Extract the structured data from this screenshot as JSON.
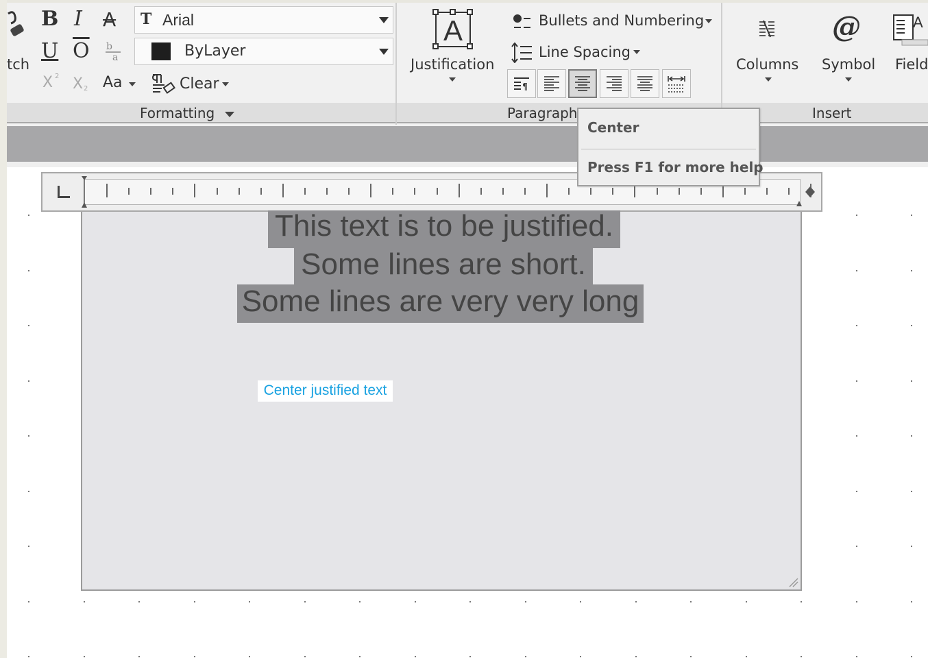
{
  "ribbon": {
    "partial_left_label": "tch",
    "formatting": {
      "bold": "B",
      "italic": "I",
      "strike": "A",
      "underline": "U",
      "overline": "O",
      "stack": "b/a",
      "superscript": "X",
      "subscript": "X",
      "change_case": "Aa",
      "font_value": "Arial",
      "color_value": "ByLayer",
      "clear_label": "Clear",
      "group_label": "Formatting"
    },
    "paragraph": {
      "justification_label": "Justification",
      "bullets_label": "Bullets and Numbering",
      "line_spacing_label": "Line Spacing",
      "group_label": "Paragraph"
    },
    "insert": {
      "columns_label": "Columns",
      "symbol_label": "Symbol",
      "field_label": "Field",
      "group_label": "Insert"
    }
  },
  "tooltip": {
    "title": "Center",
    "help": "Press F1 for more help"
  },
  "editor": {
    "lines": [
      "This text is to be justified.",
      "Some lines are short.",
      "Some lines are very very long"
    ],
    "annotation": "Center justified text"
  },
  "colors": {
    "accent_text": "#19a2e1",
    "highlight": "#8f8f92",
    "ribbon_bg": "#f1f1f1"
  }
}
